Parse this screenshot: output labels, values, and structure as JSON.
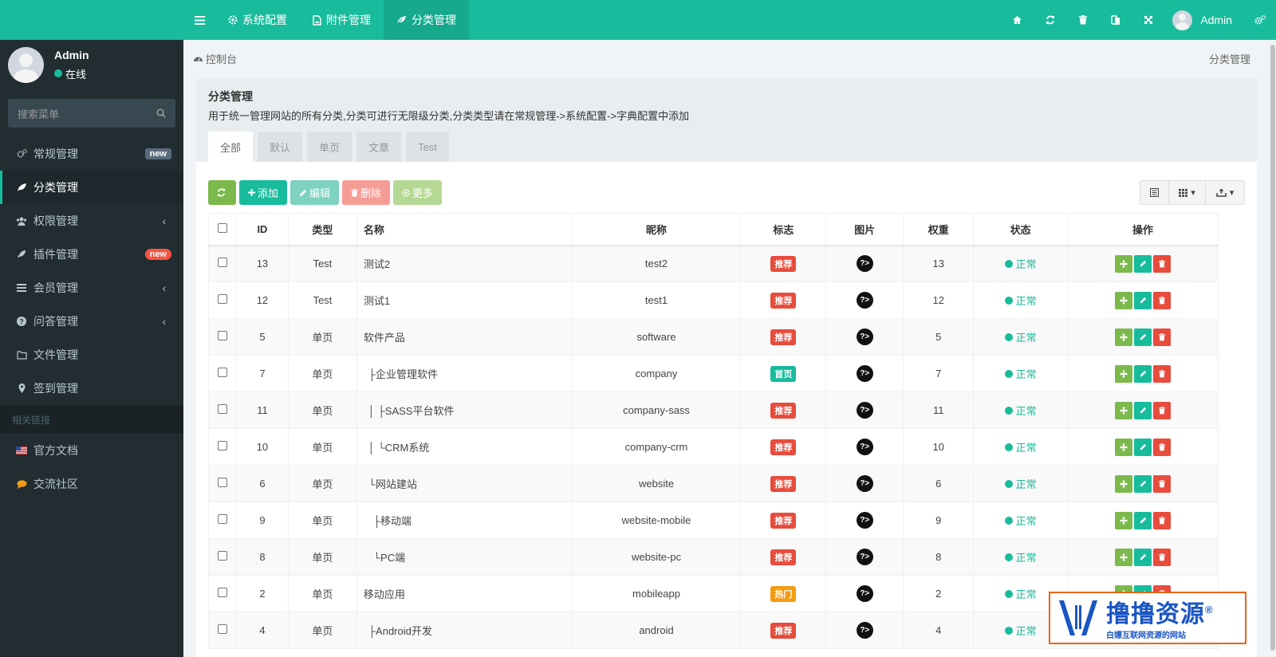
{
  "topbar": {
    "tabs": [
      {
        "label": "系统配置",
        "icon": "gear-icon"
      },
      {
        "label": "附件管理",
        "icon": "file-image-icon"
      },
      {
        "label": "分类管理",
        "icon": "leaf-icon"
      }
    ],
    "user_name": "Admin",
    "icons": [
      "home-icon",
      "refresh-icon",
      "trash-icon",
      "language-icon",
      "fullscreen-icon",
      "settings-icon"
    ]
  },
  "sidebar": {
    "user_name": "Admin",
    "user_status": "在线",
    "search_placeholder": "搜索菜单",
    "items": [
      {
        "label": "常规管理",
        "icon": "cogs-icon",
        "badge": "new",
        "badge_style": "gray"
      },
      {
        "label": "分类管理",
        "icon": "leaf-icon",
        "active": true
      },
      {
        "label": "权限管理",
        "icon": "group-icon",
        "arrow": "‹"
      },
      {
        "label": "插件管理",
        "icon": "rocket-icon",
        "badge": "new",
        "badge_style": "red"
      },
      {
        "label": "会员管理",
        "icon": "list-icon",
        "arrow": "‹"
      },
      {
        "label": "问答管理",
        "icon": "question-icon",
        "arrow": "‹"
      },
      {
        "label": "文件管理",
        "icon": "folder-icon"
      },
      {
        "label": "签到管理",
        "icon": "map-marker-icon"
      }
    ],
    "section_header": "相关链接",
    "links": [
      {
        "label": "官方文档",
        "icon": "flag-icon"
      },
      {
        "label": "交流社区",
        "icon": "comment-icon"
      }
    ]
  },
  "breadcrumb": {
    "home": "控制台",
    "current": "分类管理"
  },
  "panel": {
    "title": "分类管理",
    "description": "用于统一管理网站的所有分类,分类可进行无限级分类,分类类型请在常规管理->系统配置->字典配置中添加",
    "tabs": [
      "全部",
      "默认",
      "单页",
      "文章",
      "Test"
    ]
  },
  "toolbar": {
    "add": "添加",
    "edit": "编辑",
    "delete": "删除",
    "more": "更多"
  },
  "table": {
    "headers": [
      "ID",
      "类型",
      "名称",
      "昵称",
      "标志",
      "图片",
      "权重",
      "状态",
      "操作"
    ],
    "rows": [
      {
        "id": "13",
        "type": "Test",
        "name": "测试2",
        "nickname": "test2",
        "flag": "推荐",
        "flag_color": "#e74c3c",
        "weight": "13",
        "status": "正常"
      },
      {
        "id": "12",
        "type": "Test",
        "name": "测试1",
        "nickname": "test1",
        "flag": "推荐",
        "flag_color": "#e74c3c",
        "weight": "12",
        "status": "正常"
      },
      {
        "id": "5",
        "type": "单页",
        "name": "软件产品",
        "nickname": "software",
        "flag": "推荐",
        "flag_color": "#e74c3c",
        "weight": "5",
        "status": "正常"
      },
      {
        "id": "7",
        "type": "单页",
        "name": "├企业管理软件",
        "nickname": "company",
        "flag": "首页",
        "flag_color": "#18bc9c",
        "weight": "7",
        "status": "正常"
      },
      {
        "id": "11",
        "type": "单页",
        "name": "│ ├SASS平台软件",
        "nickname": "company-sass",
        "flag": "推荐",
        "flag_color": "#e74c3c",
        "weight": "11",
        "status": "正常"
      },
      {
        "id": "10",
        "type": "单页",
        "name": "│ └CRM系统",
        "nickname": "company-crm",
        "flag": "推荐",
        "flag_color": "#e74c3c",
        "weight": "10",
        "status": "正常"
      },
      {
        "id": "6",
        "type": "单页",
        "name": "└网站建站",
        "nickname": "website",
        "flag": "推荐",
        "flag_color": "#e74c3c",
        "weight": "6",
        "status": "正常"
      },
      {
        "id": "9",
        "type": "单页",
        "name": "├移动端",
        "nickname": "website-mobile",
        "flag": "推荐",
        "flag_color": "#e74c3c",
        "weight": "9",
        "status": "正常",
        "indent": 2
      },
      {
        "id": "8",
        "type": "单页",
        "name": "└PC端",
        "nickname": "website-pc",
        "flag": "推荐",
        "flag_color": "#e74c3c",
        "weight": "8",
        "status": "正常",
        "indent": 2
      },
      {
        "id": "2",
        "type": "单页",
        "name": "移动应用",
        "nickname": "mobileapp",
        "flag": "热门",
        "flag_color": "#f39c12",
        "weight": "2",
        "status": "正常"
      },
      {
        "id": "4",
        "type": "单页",
        "name": "├Android开发",
        "nickname": "android",
        "flag": "推荐",
        "flag_color": "#e74c3c",
        "weight": "4",
        "status": "正常"
      }
    ]
  },
  "watermark": {
    "title": "撸撸资源",
    "subtitle": "白嫖互联网资源的网站",
    "mark": "®"
  }
}
